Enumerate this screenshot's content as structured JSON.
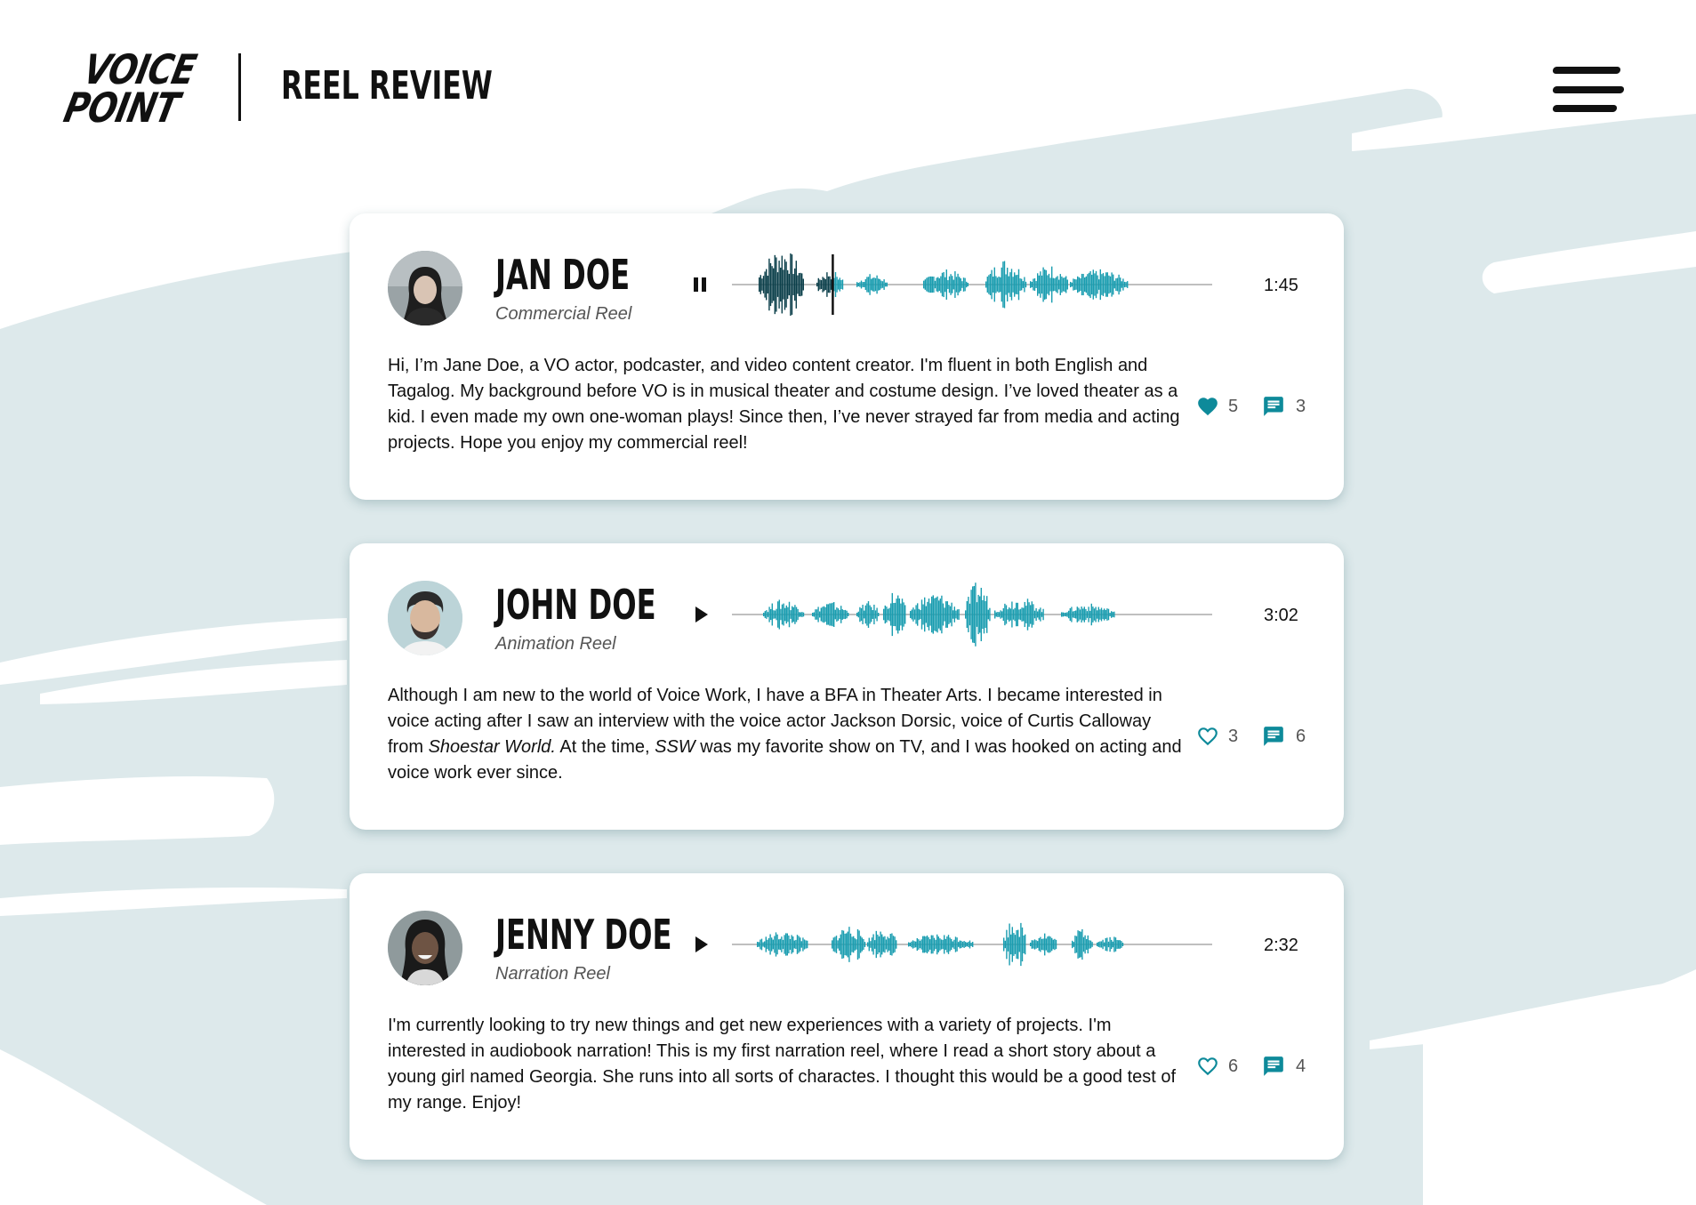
{
  "brand": {
    "logo_line1": "VOICE",
    "logo_line2": "POINT"
  },
  "header": {
    "title": "REEL REVIEW",
    "menu_icon": "hamburger-menu-icon"
  },
  "colors": {
    "accent": "#0e8a9a",
    "wave_played": "#0b3f4a",
    "wave": "#1a9db0",
    "background_swoosh": "#dde9eb"
  },
  "reels": [
    {
      "name": "JAN DOE",
      "reel_type": "Commercial Reel",
      "player_state": "playing",
      "duration": "1:45",
      "progress": 0.21,
      "bio": "Hi, I’m Jane Doe, a VO actor, podcaster, and video content creator. I'm fluent in both English and Tagalog. My background before VO is in musical theater and costume design. I’ve loved theater as a kid. I even made my own one-woman plays! Since then, I’ve never strayed far from media and acting projects. Hope you enjoy my commercial reel!",
      "likes": "5",
      "liked": true,
      "comments": "3"
    },
    {
      "name": "JOHN DOE",
      "reel_type": "Animation Reel",
      "player_state": "paused",
      "duration": "3:02",
      "progress": 0,
      "bio_parts": {
        "p1": "Although I am new to the world of Voice Work, I have a BFA in Theater Arts. I became interested in voice acting after I saw an interview with the voice actor Jackson Dorsic, voice of Curtis Calloway from ",
        "show": "Shoestar World.",
        "p2": " At the time, ",
        "abbr": "SSW",
        "p3": " was my favorite show on TV, and I was hooked on acting and voice work ever since."
      },
      "likes": "3",
      "liked": false,
      "comments": "6"
    },
    {
      "name": "JENNY DOE",
      "reel_type": "Narration Reel",
      "player_state": "paused",
      "duration": "2:32",
      "progress": 0,
      "bio": "I'm currently looking to try new things and get new experiences with a variety of projects. I'm interested in audiobook narration! This is my first narration reel, where I read a short story about a young girl named Georgia. She runs into all sorts of charactes. I thought this would be a good test of my range. Enjoy!",
      "likes": "6",
      "liked": false,
      "comments": "4"
    }
  ]
}
